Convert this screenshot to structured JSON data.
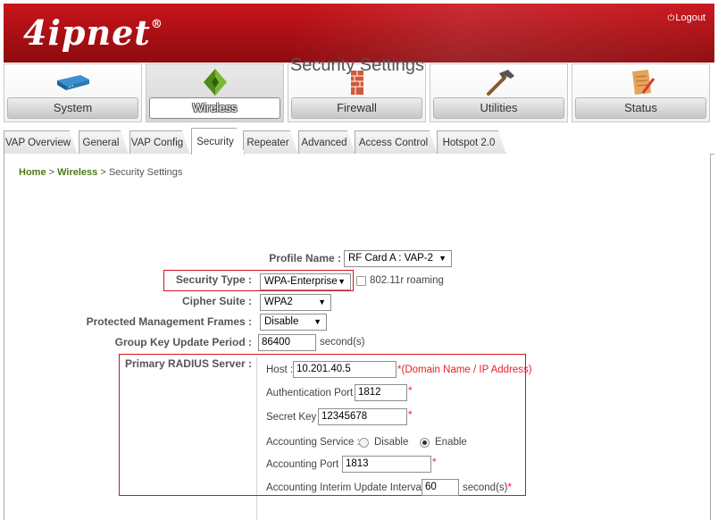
{
  "header": {
    "logo": "4ipnet",
    "logo_mark": "®",
    "logout_label": "Logout"
  },
  "main_nav": [
    {
      "label": "System",
      "icon": "server-icon"
    },
    {
      "label": "Wireless",
      "icon": "wireless-diamond-icon",
      "active": true
    },
    {
      "label": "Firewall",
      "icon": "firewall-brick-icon"
    },
    {
      "label": "Utilities",
      "icon": "hammer-icon"
    },
    {
      "label": "Status",
      "icon": "document-pencil-icon"
    }
  ],
  "sub_tabs": [
    {
      "label": "VAP Overview"
    },
    {
      "label": "General"
    },
    {
      "label": "VAP Config"
    },
    {
      "label": "Security",
      "active": true
    },
    {
      "label": "Repeater"
    },
    {
      "label": "Advanced"
    },
    {
      "label": "Access Control"
    },
    {
      "label": "Hotspot 2.0"
    }
  ],
  "breadcrumb": {
    "home": "Home",
    "sep1": ">",
    "section": "Wireless",
    "sep2": ">",
    "page": "Security Settings"
  },
  "page_title": "Security Settings",
  "form": {
    "profile_name": {
      "label": "Profile Name :",
      "value": "RF Card A : VAP-2"
    },
    "security_type": {
      "label": "Security Type :",
      "value": "WPA-Enterprise",
      "roaming_label": "802.11r roaming",
      "roaming_checked": false
    },
    "cipher_suite": {
      "label": "Cipher Suite :",
      "value": "WPA2"
    },
    "pmf": {
      "label": "Protected Management Frames :",
      "value": "Disable"
    },
    "group_key": {
      "label": "Group Key Update Period :",
      "value": "86400",
      "unit": "second(s)"
    },
    "radius": {
      "label": "Primary RADIUS Server :",
      "host_label": "Host :",
      "host_value": "10.201.40.5",
      "host_hint": "(Domain Name / IP Address)",
      "auth_port_label": "Authentication Port :",
      "auth_port_value": "1812",
      "secret_label": "Secret Key :",
      "secret_value": "12345678",
      "acct_service_label": "Accounting Service :",
      "acct_disable": "Disable",
      "acct_enable": "Enable",
      "acct_selected": "Enable",
      "acct_port_label": "Accounting Port :",
      "acct_port_value": "1813",
      "interim_label": "Accounting Interim Update Interval :",
      "interim_value": "60",
      "interim_unit": "second(s)"
    },
    "required_mark": "*"
  },
  "colors": {
    "header_red": "#b3121a",
    "link_green": "#4d7a17",
    "highlight_red": "#d6151c"
  }
}
